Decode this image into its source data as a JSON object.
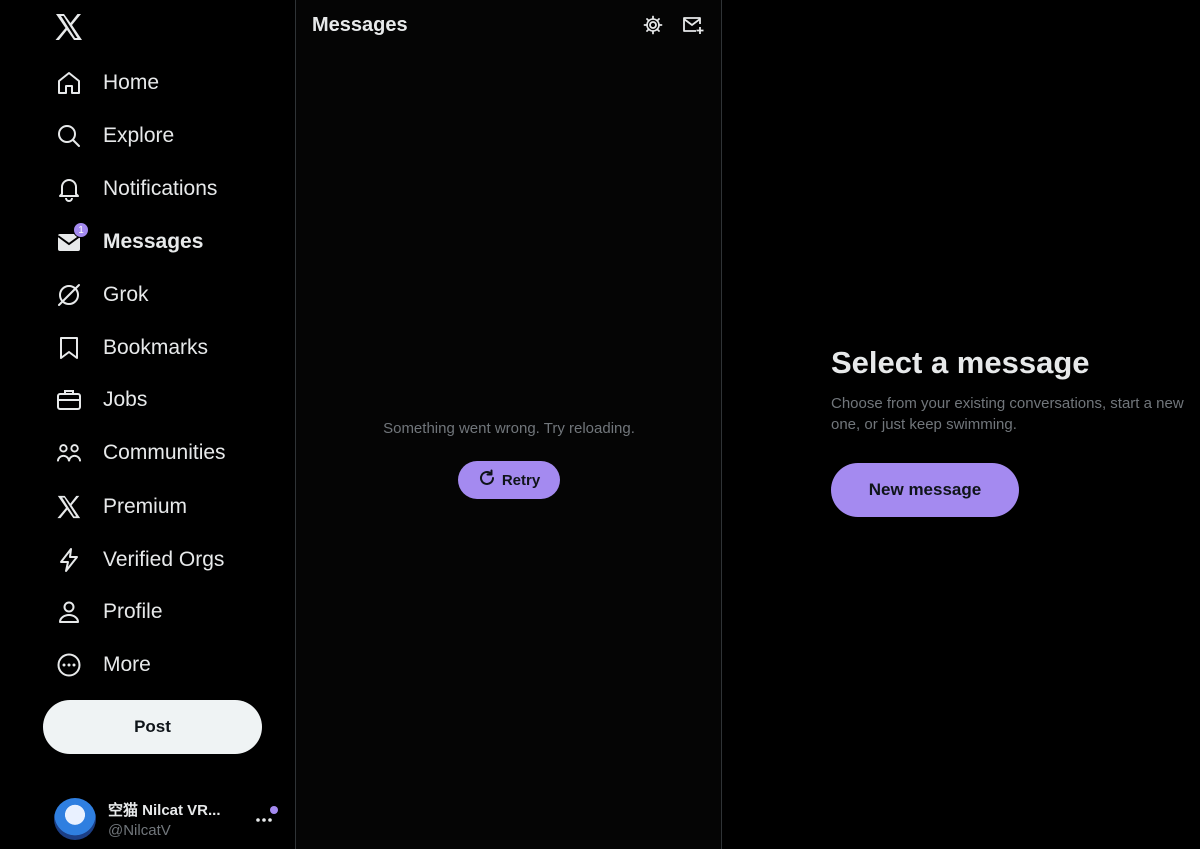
{
  "colors": {
    "background": "#000000",
    "accent": "#a48af0",
    "text": "#e7e9ea",
    "muted": "#71767b",
    "border": "#2f3336"
  },
  "sidebar": {
    "logo_icon": "x-logo-icon",
    "items": [
      {
        "label": "Home",
        "icon": "home-icon"
      },
      {
        "label": "Explore",
        "icon": "search-icon"
      },
      {
        "label": "Notifications",
        "icon": "bell-icon"
      },
      {
        "label": "Messages",
        "icon": "envelope-icon",
        "badge": "1",
        "active": true
      },
      {
        "label": "Grok",
        "icon": "grok-icon"
      },
      {
        "label": "Bookmarks",
        "icon": "bookmark-icon"
      },
      {
        "label": "Jobs",
        "icon": "briefcase-icon"
      },
      {
        "label": "Communities",
        "icon": "communities-icon"
      },
      {
        "label": "Premium",
        "icon": "x-logo-icon"
      },
      {
        "label": "Verified Orgs",
        "icon": "lightning-icon"
      },
      {
        "label": "Profile",
        "icon": "person-icon"
      },
      {
        "label": "More",
        "icon": "more-circle-icon"
      }
    ],
    "post_label": "Post",
    "account": {
      "name": "空猫 Nilcat VR...",
      "handle": "@NilcatV"
    }
  },
  "messages": {
    "title": "Messages",
    "error": "Something went wrong. Try reloading.",
    "retry_label": "Retry"
  },
  "right": {
    "title": "Select a message",
    "subtitle": "Choose from your existing conversations, start a new one, or just keep swimming.",
    "button_label": "New message"
  }
}
